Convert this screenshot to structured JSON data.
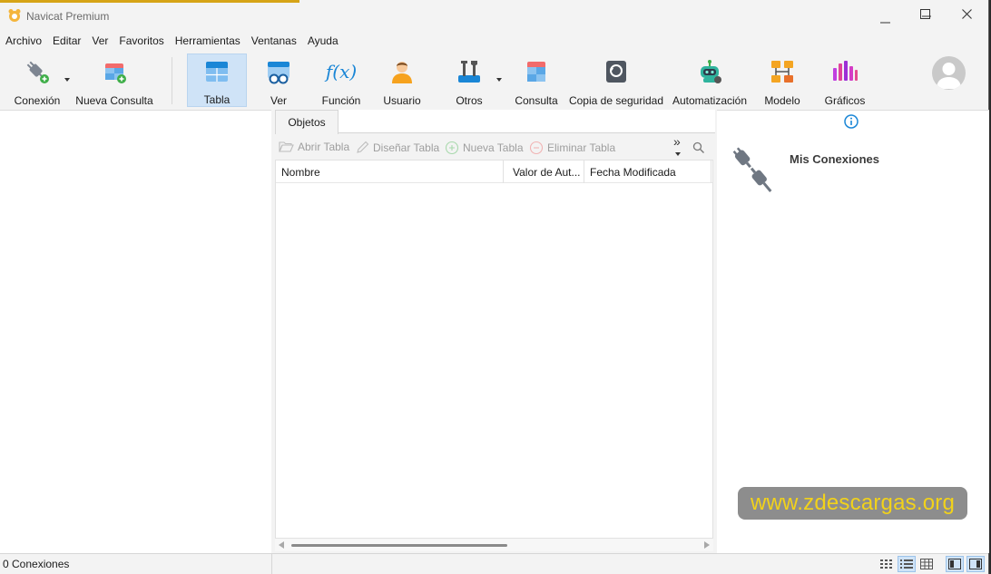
{
  "window": {
    "title": "Navicat Premium"
  },
  "menu": [
    "Archivo",
    "Editar",
    "Ver",
    "Favoritos",
    "Herramientas",
    "Ventanas",
    "Ayuda"
  ],
  "toolbar": {
    "conexion": "Conexión",
    "nueva_consulta": "Nueva Consulta",
    "tabla": "Tabla",
    "ver": "Ver",
    "funcion": "Función",
    "usuario": "Usuario",
    "otros": "Otros",
    "consulta": "Consulta",
    "copia": "Copia de seguridad",
    "automatizacion": "Automatización",
    "modelo": "Modelo",
    "graficos": "Gráficos",
    "funcion_glyph": "f(x)"
  },
  "objects": {
    "tab_label": "Objetos",
    "actions": {
      "abrir": "Abrir Tabla",
      "disenar": "Diseñar Tabla",
      "nueva": "Nueva Tabla",
      "eliminar": "Eliminar Tabla"
    },
    "more_glyph": "»",
    "columns": [
      "Nombre",
      "Valor de Aut...",
      "Fecha Modificada"
    ]
  },
  "info_panel": {
    "title": "Mis Conexiones"
  },
  "watermark": "www.zdescargas.org",
  "status": {
    "connections": "0 Conexiones"
  },
  "colors": {
    "accent": "#1a86d6",
    "active_bg": "#cfe3f7",
    "watermark_bg": "#8d8d8d",
    "watermark_text": "#f2d21a"
  }
}
